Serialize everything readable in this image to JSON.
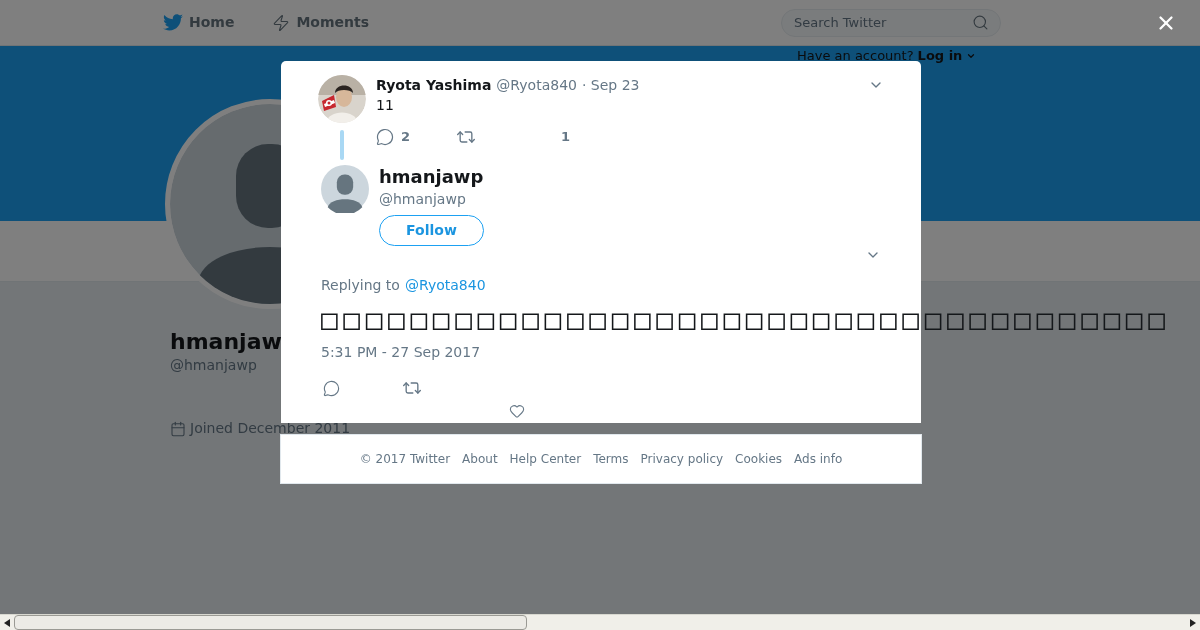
{
  "nav": {
    "items": [
      {
        "label": "Home",
        "kind": "home"
      },
      {
        "label": "Moments",
        "kind": "moments"
      }
    ]
  },
  "search": {
    "placeholder": "Search Twitter"
  },
  "login_prompt": {
    "text": "Have an account?",
    "link": "Log in"
  },
  "profile": {
    "name": "hmanjaw",
    "handle": "@hmanjawp",
    "joined": "Joined December 2011"
  },
  "modal": {
    "parent_tweet": {
      "name": "Ryota Yashima",
      "handle": "@Ryota840",
      "date": "· Sep 23",
      "text": "11",
      "reply_count": "2",
      "like_count": "1"
    },
    "tweet": {
      "name": "hmanjawp",
      "handle": "@hmanjawp",
      "follow_label": "Follow",
      "replying_prefix": "Replying to",
      "replying_to": "@Ryota840",
      "text": "□□□□□□□□□□□□□□□□□□□□□□□□□□□□□□□□□□□□□□",
      "timestamp": "5:31 PM - 27 Sep 2017"
    }
  },
  "footer": {
    "links": [
      "© 2017 Twitter",
      "About",
      "Help Center",
      "Terms",
      "Privacy policy",
      "Cookies",
      "Ads info"
    ]
  }
}
